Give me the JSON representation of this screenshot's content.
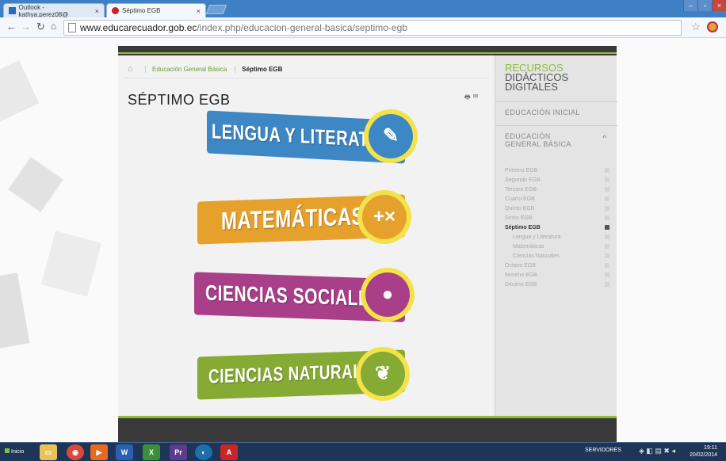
{
  "browser": {
    "tabs": [
      {
        "label": "Outlook - kathya.perez08@",
        "active": false
      },
      {
        "label": "Séptimo EGB",
        "active": true
      }
    ],
    "url_domain": "www.educarecuador.gob.ec",
    "url_path": "/index.php/educacion-general-basica/septimo-egb"
  },
  "breadcrumb": {
    "items": [
      "Educación General Básica",
      "Séptimo EGB"
    ]
  },
  "page": {
    "title": "SÉPTIMO EGB",
    "subjects": [
      {
        "label": "LENGUA Y LITERATURA",
        "color": "#3d87c4",
        "icon": "feather-icon"
      },
      {
        "label": "MATEMÁTICAS",
        "color": "#e6a12c",
        "icon": "plus-times-icon"
      },
      {
        "label": "CIENCIAS SOCIALES",
        "color": "#a93f89",
        "icon": "ecuador-map-icon"
      },
      {
        "label": "CIENCIAS NATURALES",
        "color": "#86ab34",
        "icon": "leaf-icon"
      }
    ]
  },
  "sidebar": {
    "title_line1": "RECURSOS",
    "title_line2": "DIDÁCTICOS",
    "title_line3": "DIGITALES",
    "sections": [
      "EDUCACIÓN INICIAL",
      "EDUCACIÓN GENERAL BÁSICA"
    ],
    "grades": [
      {
        "label": "Primero EGB",
        "current": false,
        "indent": false
      },
      {
        "label": "Segundo EGB",
        "current": false,
        "indent": false
      },
      {
        "label": "Tercero EGB",
        "current": false,
        "indent": false
      },
      {
        "label": "Cuarto EGB",
        "current": false,
        "indent": false
      },
      {
        "label": "Quinto EGB",
        "current": false,
        "indent": false
      },
      {
        "label": "Sexto EGB",
        "current": false,
        "indent": false
      },
      {
        "label": "Séptimo EGB",
        "current": true,
        "indent": false
      },
      {
        "label": "Lengua y Literatura",
        "current": false,
        "indent": true
      },
      {
        "label": "Matemáticas",
        "current": false,
        "indent": true
      },
      {
        "label": "Ciencias Naturales",
        "current": false,
        "indent": true
      },
      {
        "label": "Octavo EGB",
        "current": false,
        "indent": false
      },
      {
        "label": "Noveno EGB",
        "current": false,
        "indent": false
      },
      {
        "label": "Décimo EGB",
        "current": false,
        "indent": false
      }
    ]
  },
  "taskbar": {
    "start_label": "Inicio",
    "tray_label": "SERVIDORES",
    "time": "19:11",
    "date": "20/02/2014"
  }
}
